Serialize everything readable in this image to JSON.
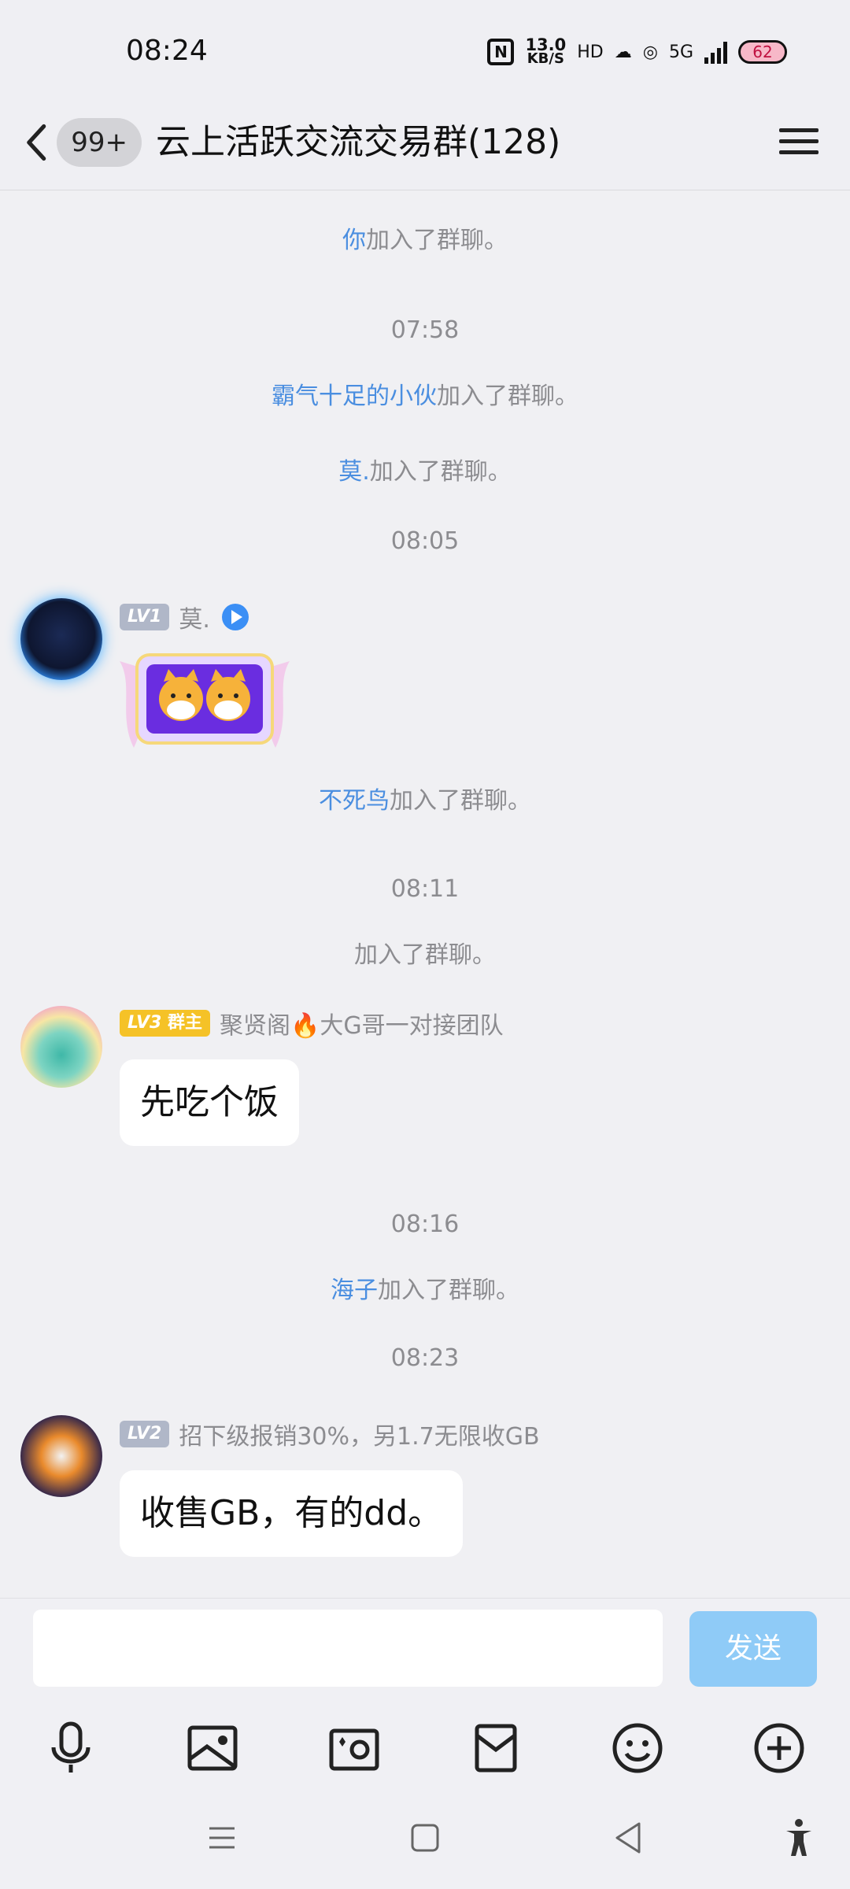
{
  "status_bar": {
    "time": "08:24",
    "net_speed_value": "13.0",
    "net_speed_unit": "KB/S",
    "net_hd": "HD",
    "network_type": "5G",
    "battery": "62"
  },
  "header": {
    "unread_count": "99+",
    "title": "云上活跃交流交易群(128)"
  },
  "chat": {
    "items": [
      {
        "kind": "system",
        "actor": "你",
        "text": "加入了群聊。"
      },
      {
        "kind": "time",
        "text": "07:58"
      },
      {
        "kind": "system",
        "actor": "霸气十足的小伙",
        "text": "加入了群聊。"
      },
      {
        "kind": "system",
        "actor": "莫.",
        "text": "加入了群聊。"
      },
      {
        "kind": "time",
        "text": "08:05"
      },
      {
        "kind": "message",
        "level": "LV1",
        "sender": "莫.",
        "content_type": "sticker"
      },
      {
        "kind": "system",
        "actor": "不死鸟",
        "text": "加入了群聊。"
      },
      {
        "kind": "time",
        "text": "08:11"
      },
      {
        "kind": "system",
        "actor": "",
        "text": "加入了群聊。"
      },
      {
        "kind": "message",
        "level": "LV3",
        "role": "群主",
        "sender": "聚贤阁🔥大G哥一对接团队",
        "text": "先吃个饭"
      },
      {
        "kind": "time",
        "text": "08:16"
      },
      {
        "kind": "system",
        "actor": "海子",
        "text": "加入了群聊。"
      },
      {
        "kind": "time",
        "text": "08:23"
      },
      {
        "kind": "message",
        "level": "LV2",
        "sender": "招下级报销30%，另1.7无限收GB",
        "text": "收售GB，有的dd。"
      }
    ]
  },
  "input": {
    "placeholder": "",
    "send_label": "发送"
  },
  "toolbar": {
    "icons": [
      "microphone-icon",
      "image-icon",
      "camera-icon",
      "red-packet-icon",
      "emoji-icon",
      "plus-icon"
    ]
  },
  "colors": {
    "link": "#4a8ee0",
    "send_button": "#8fcbf7",
    "owner_badge": "#f5c227",
    "level_badge": "#b0b7c8"
  }
}
